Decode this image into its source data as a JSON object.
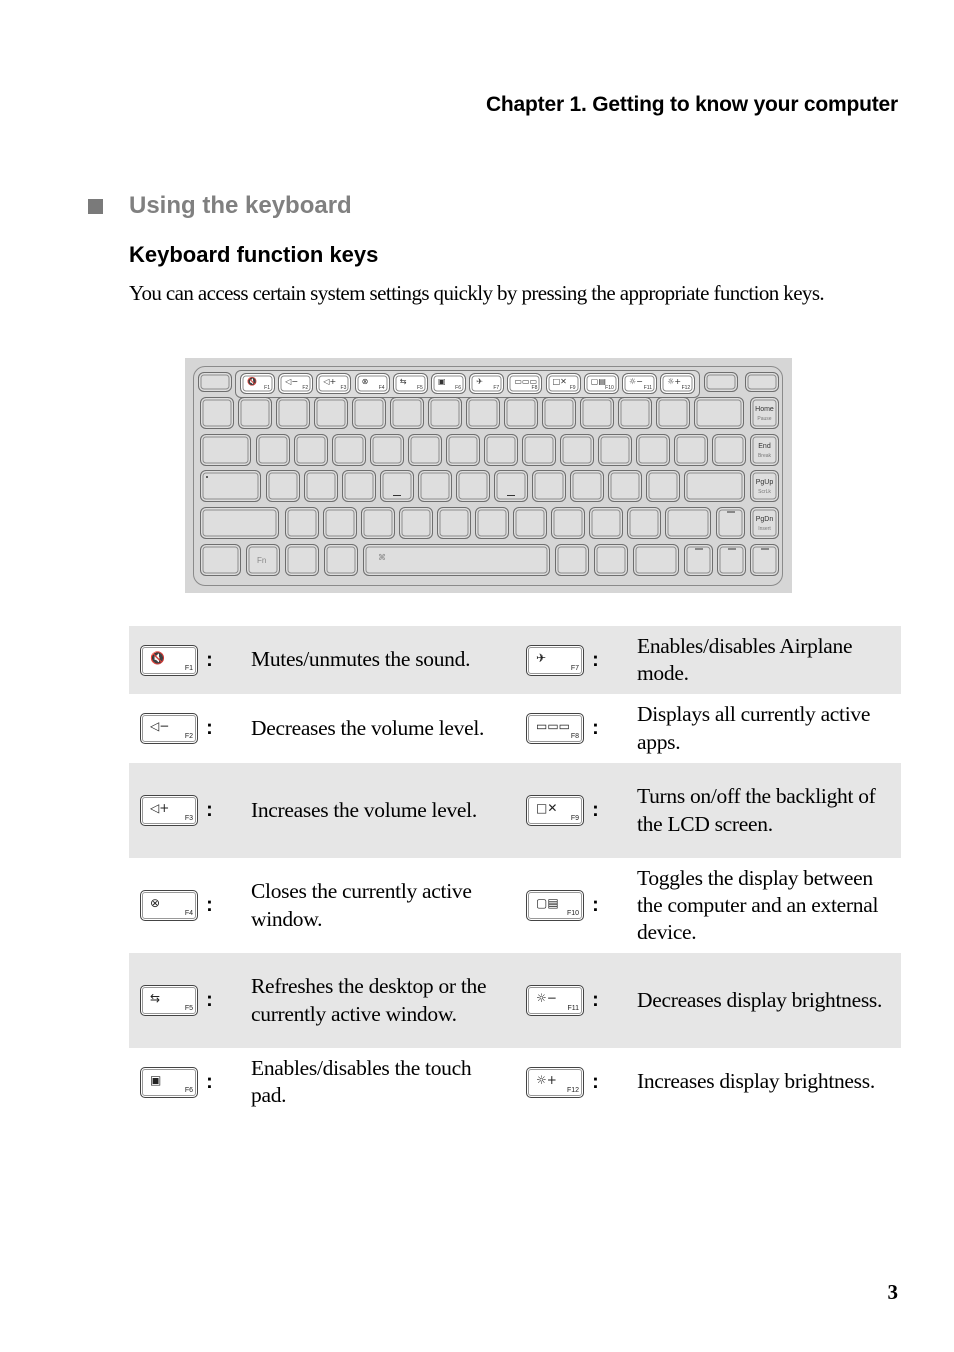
{
  "header": {
    "chapter": "Chapter 1. Getting to know your computer"
  },
  "section": {
    "title": "Using the keyboard",
    "subheading": "Keyboard function keys",
    "intro": "You can access certain system settings quickly by pressing the appropriate function keys."
  },
  "keyboard_illustration": {
    "function_row": [
      {
        "label": "F1",
        "icon": "mute-icon",
        "glyph": "🔇"
      },
      {
        "label": "F2",
        "icon": "volume-down-icon",
        "glyph": "◁−"
      },
      {
        "label": "F3",
        "icon": "volume-up-icon",
        "glyph": "◁+"
      },
      {
        "label": "F4",
        "icon": "close-window-icon",
        "glyph": "⊗"
      },
      {
        "label": "F5",
        "icon": "refresh-icon",
        "glyph": "⇆"
      },
      {
        "label": "F6",
        "icon": "touchpad-icon",
        "glyph": "▣"
      },
      {
        "label": "F7",
        "icon": "airplane-icon",
        "glyph": "✈"
      },
      {
        "label": "F8",
        "icon": "active-apps-icon",
        "glyph": "▭▭▭"
      },
      {
        "label": "F9",
        "icon": "backlight-off-icon",
        "glyph": "□✕"
      },
      {
        "label": "F10",
        "icon": "display-toggle-icon",
        "glyph": "▢▤"
      },
      {
        "label": "F11",
        "icon": "brightness-down-icon",
        "glyph": "☼−"
      },
      {
        "label": "F12",
        "icon": "brightness-up-icon",
        "glyph": "☼+"
      }
    ],
    "nav_keys": [
      {
        "primary": "Home",
        "secondary": "Pause"
      },
      {
        "primary": "End",
        "secondary": "Break"
      },
      {
        "primary": "PgUp",
        "secondary": "ScrLk"
      },
      {
        "primary": "PgDn",
        "secondary": "Insert"
      }
    ],
    "fn_key_label": "Fn",
    "windows_key_glyph": "⌘"
  },
  "function_keys": {
    "colon": ":",
    "rows": [
      [
        {
          "key": "F1",
          "icon": "mute-icon",
          "glyph": "🔇",
          "description": "Mutes/unmutes the sound."
        },
        {
          "key": "F7",
          "icon": "airplane-icon",
          "glyph": "✈",
          "description": "Enables/disables Airplane mode."
        }
      ],
      [
        {
          "key": "F2",
          "icon": "volume-down-icon",
          "glyph": "◁−",
          "description": "Decreases the volume level."
        },
        {
          "key": "F8",
          "icon": "active-apps-icon",
          "glyph": "▭▭▭",
          "description": "Displays all currently active apps."
        }
      ],
      [
        {
          "key": "F3",
          "icon": "volume-up-icon",
          "glyph": "◁+",
          "description": "Increases the volume level."
        },
        {
          "key": "F9",
          "icon": "backlight-off-icon",
          "glyph": "□✕",
          "description": "Turns on/off the backlight of the LCD screen."
        }
      ],
      [
        {
          "key": "F4",
          "icon": "close-window-icon",
          "glyph": "⊗",
          "description": "Closes the currently active window."
        },
        {
          "key": "F10",
          "icon": "display-toggle-icon",
          "glyph": "▢▤",
          "description": "Toggles the display between the computer and an external device."
        }
      ],
      [
        {
          "key": "F5",
          "icon": "refresh-icon",
          "glyph": "⇆",
          "description": "Refreshes the desktop or the currently active window."
        },
        {
          "key": "F11",
          "icon": "brightness-down-icon",
          "glyph": "☼−",
          "description": "Decreases display brightness."
        }
      ],
      [
        {
          "key": "F6",
          "icon": "touchpad-icon",
          "glyph": "▣",
          "description": "Enables/disables the touch pad."
        },
        {
          "key": "F12",
          "icon": "brightness-up-icon",
          "glyph": "☼+",
          "description": "Increases display brightness."
        }
      ]
    ]
  },
  "page_number": "3",
  "colors": {
    "row_shade": "#e6e6e6",
    "keyboard_bg": "#d6d6d6",
    "section_title": "#808080"
  }
}
